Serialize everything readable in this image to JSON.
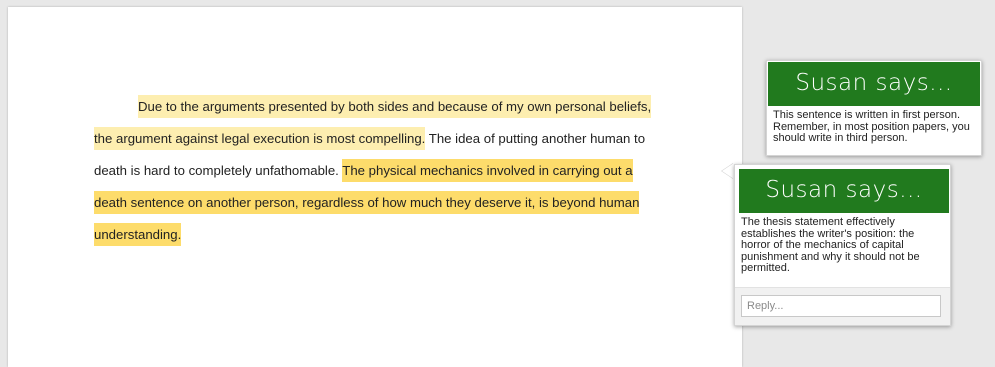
{
  "document": {
    "lines": [
      {
        "segments": [
          {
            "text": "Due to the arguments presented by both sides and because of my own personal beliefs,",
            "style": "light"
          }
        ]
      },
      {
        "segments": [
          {
            "text": "the argument against legal execution is most compelling.",
            "style": "light"
          },
          {
            "text": " The idea of putting another human to",
            "style": "none"
          }
        ]
      },
      {
        "segments": [
          {
            "text": "death is hard to completely unfathomable. ",
            "style": "none"
          },
          {
            "text": "The physical mechanics involved in carrying out a",
            "style": "dark"
          }
        ]
      },
      {
        "segments": [
          {
            "text": "death sentence on another person, regardless of how much they deserve it, is beyond human",
            "style": "dark"
          }
        ]
      },
      {
        "segments": [
          {
            "text": "understanding.",
            "style": "dark"
          }
        ]
      }
    ]
  },
  "comments": [
    {
      "banner": "Susan says...",
      "body": "This sentence is written in first person. Remember, in most position papers, you should write in third person."
    },
    {
      "banner": "Susan says...",
      "body": "The thesis statement effectively establishes the writer's position: the horror of the mechanics of capital punishment and why it should not be permitted.",
      "reply_placeholder": "Reply..."
    }
  ],
  "colors": {
    "banner_green": "#217a1e",
    "highlight_light": "#fdeeb0",
    "highlight_dark": "#fddc6b"
  }
}
